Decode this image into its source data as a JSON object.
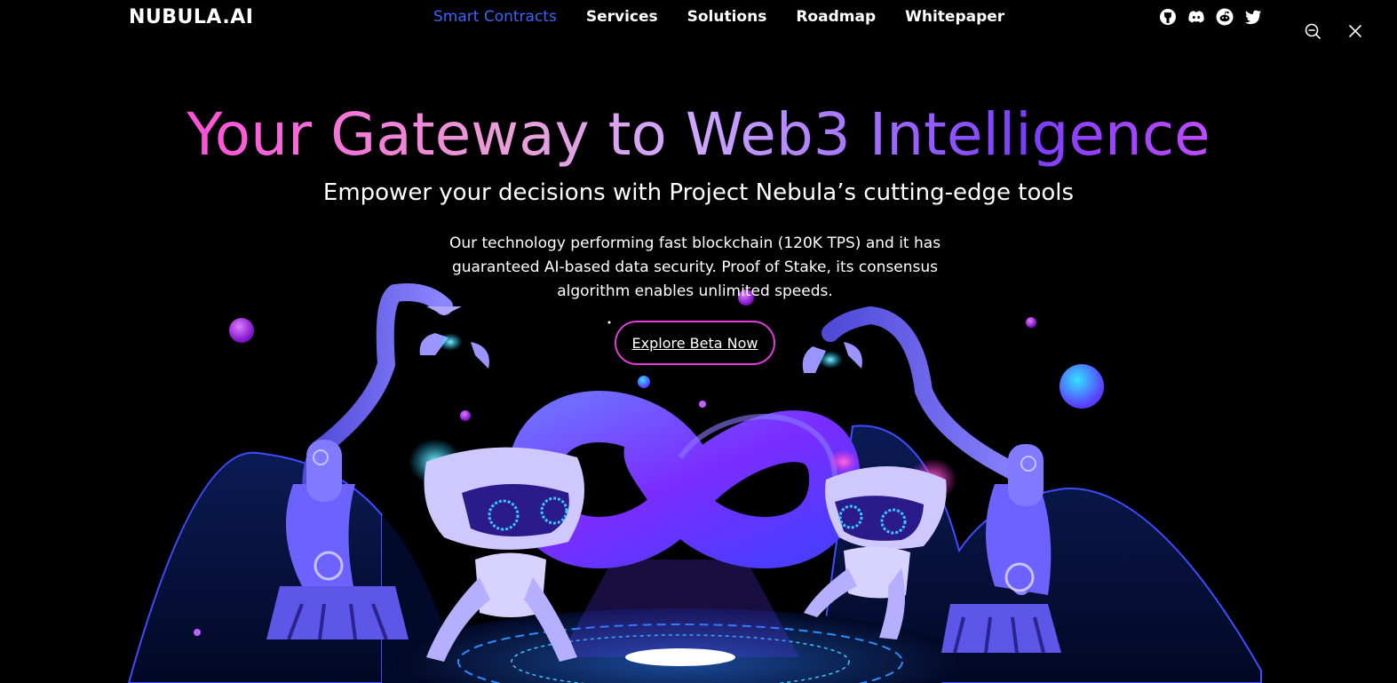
{
  "nav": {
    "logo": "NUBULA.AI",
    "links": [
      {
        "label": "Smart Contracts",
        "active": true
      },
      {
        "label": "Services"
      },
      {
        "label": "Solutions"
      },
      {
        "label": "Roadmap"
      },
      {
        "label": "Whitepaper"
      }
    ],
    "socials": [
      "github-icon",
      "discord-icon",
      "reddit-icon",
      "twitter-icon"
    ]
  },
  "window_controls": [
    "zoom-out-icon",
    "close-icon"
  ],
  "hero": {
    "title": "Your Gateway to Web3 Intelligence",
    "subtitle": "Empower your decisions with Project Nebula’s cutting-edge tools",
    "body": "Our technology performing fast blockchain (120K TPS) and it has guaranteed AI-based data security. Proof of Stake, its consensus algorithm enables unlimited speeds.",
    "cta_label": "Explore Beta Now"
  },
  "colors": {
    "active_link": "#3d63ff",
    "cta_border": "#e23ddc",
    "title_gradient": [
      "#ff4fd8",
      "#e9a0d8",
      "#cda6ff",
      "#7a3dff",
      "#c04bff"
    ]
  }
}
